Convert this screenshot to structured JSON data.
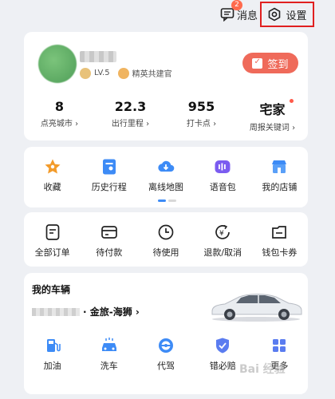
{
  "topbar": {
    "messages_label": "消息",
    "messages_badge": "2",
    "settings_label": "设置"
  },
  "profile": {
    "level": "LV.5",
    "title_badge": "精英共建官",
    "signin_label": "签到",
    "stats": [
      {
        "value": "8",
        "label": "点亮城市 ›"
      },
      {
        "value": "22.3",
        "label": "出行里程 ›"
      },
      {
        "value": "955",
        "label": "打卡点 ›"
      },
      {
        "value": "宅家",
        "label": "周报关键词 ›"
      }
    ]
  },
  "quick": {
    "items": [
      {
        "label": "收藏",
        "icon": "star-icon"
      },
      {
        "label": "历史行程",
        "icon": "history-trip-icon"
      },
      {
        "label": "离线地图",
        "icon": "cloud-download-icon"
      },
      {
        "label": "语音包",
        "icon": "voice-pack-icon"
      },
      {
        "label": "我的店铺",
        "icon": "shop-icon"
      }
    ]
  },
  "orders": {
    "items": [
      {
        "label": "全部订单",
        "icon": "order-list-icon"
      },
      {
        "label": "待付款",
        "icon": "wallet-card-icon"
      },
      {
        "label": "待使用",
        "icon": "clock-icon"
      },
      {
        "label": "退款/取消",
        "icon": "refund-icon"
      },
      {
        "label": "钱包卡券",
        "icon": "coupon-icon"
      }
    ]
  },
  "vehicle": {
    "title": "我的车辆",
    "car_name": "· 金旅-海狮 ›"
  },
  "services": {
    "items": [
      {
        "label": "加油",
        "icon": "fuel-icon"
      },
      {
        "label": "洗车",
        "icon": "car-wash-icon"
      },
      {
        "label": "代驾",
        "icon": "steering-wheel-icon"
      },
      {
        "label": "错必赔",
        "icon": "shield-check-icon"
      },
      {
        "label": "更多",
        "icon": "more-grid-icon"
      }
    ]
  },
  "watermark": "Bai 经验",
  "colors": {
    "accent_blue": "#3d8bf6",
    "signin_red": "#ef6a5a",
    "highlight_border": "#e02020",
    "orange": "#f39b2a"
  }
}
